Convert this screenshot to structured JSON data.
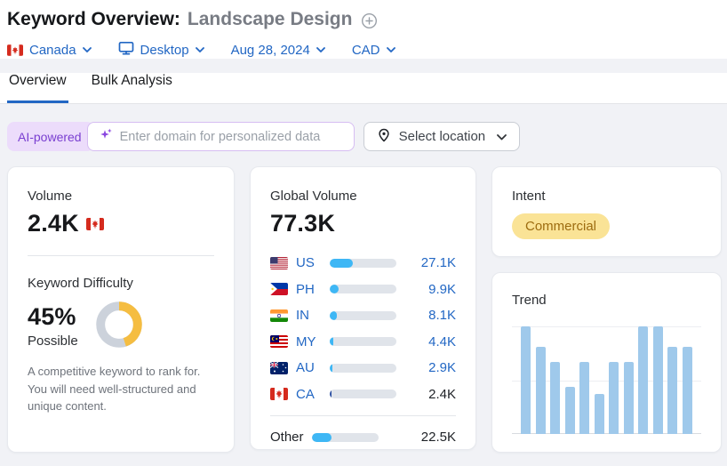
{
  "header": {
    "title": "Keyword Overview:",
    "keyword": "Landscape Design"
  },
  "filters": {
    "country": "Canada",
    "device": "Desktop",
    "date": "Aug 28, 2024",
    "currency": "CAD"
  },
  "tabs": [
    {
      "label": "Overview",
      "active": true
    },
    {
      "label": "Bulk Analysis",
      "active": false
    }
  ],
  "search": {
    "ai_badge": "AI-powered",
    "domain_placeholder": "Enter domain for personalized data",
    "location_label": "Select location"
  },
  "volume": {
    "label": "Volume",
    "value": "2.4K",
    "flag": "canada-flag"
  },
  "difficulty": {
    "label": "Keyword Difficulty",
    "percent": "45%",
    "percent_value": 45,
    "level": "Possible",
    "description": "A competitive keyword to rank for. You will need well-structured and unique content."
  },
  "global_volume": {
    "label": "Global Volume",
    "value": "77.3K",
    "rows": [
      {
        "code": "US",
        "flag": "us-flag",
        "value": "27.1K",
        "share": 35.0,
        "highlight": false
      },
      {
        "code": "PH",
        "flag": "ph-flag",
        "value": "9.9K",
        "share": 12.8,
        "highlight": false
      },
      {
        "code": "IN",
        "flag": "in-flag",
        "value": "8.1K",
        "share": 10.5,
        "highlight": false
      },
      {
        "code": "MY",
        "flag": "my-flag",
        "value": "4.4K",
        "share": 5.7,
        "highlight": false
      },
      {
        "code": "AU",
        "flag": "au-flag",
        "value": "2.9K",
        "share": 3.8,
        "highlight": false
      },
      {
        "code": "CA",
        "flag": "ca-flag",
        "value": "2.4K",
        "share": 3.1,
        "highlight": true
      }
    ],
    "other": {
      "label": "Other",
      "value": "22.5K",
      "share": 29.1
    }
  },
  "intent": {
    "label": "Intent",
    "badge": "Commercial"
  },
  "trend": {
    "label": "Trend",
    "type": "bar",
    "values": [
      100,
      81,
      67,
      44,
      67,
      37,
      67,
      67,
      100,
      100,
      81,
      81
    ]
  },
  "colors": {
    "accent_blue": "#2267c4",
    "bar_fill_blue": "#3eb7f5",
    "highlight_navy": "#2a4fa2",
    "track_gray": "#e0e4ea",
    "kd_yellow": "#f5bd41",
    "kd_gray": "#ccd2db",
    "intent_bg": "#fae396",
    "intent_text": "#9d6c10",
    "trend_bar": "#9fc9eb",
    "page_bg": "#f1f2f6",
    "ai_purple": "#7a3fd1"
  }
}
